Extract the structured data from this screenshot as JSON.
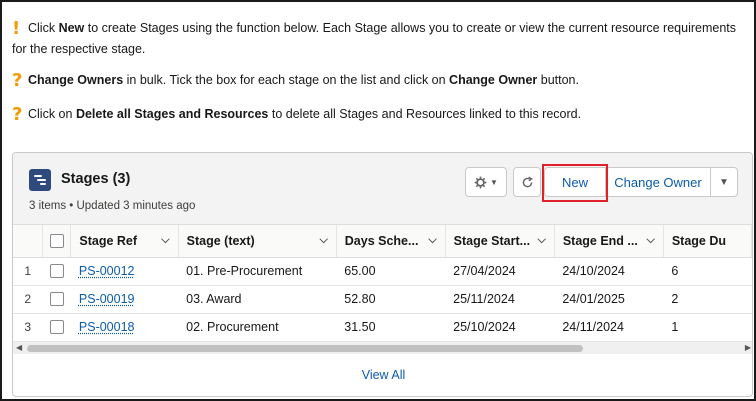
{
  "notes": [
    {
      "icon": "!",
      "parts": [
        {
          "t": "Click ",
          "b": false
        },
        {
          "t": "New",
          "b": true
        },
        {
          "t": " to create Stages using the function below. Each Stage allows you to create or view the current resource requirements for the respective stage.",
          "b": false
        }
      ]
    },
    {
      "icon": "?",
      "parts": [
        {
          "t": "Change Owners",
          "b": true
        },
        {
          "t": " in bulk. Tick the box for each stage on the list and click on ",
          "b": false
        },
        {
          "t": "Change Owner",
          "b": true
        },
        {
          "t": " button.",
          "b": false
        }
      ]
    },
    {
      "icon": "?",
      "parts": [
        {
          "t": "Click on ",
          "b": false
        },
        {
          "t": "Delete all Stages and Resources",
          "b": true
        },
        {
          "t": " to delete all Stages and Resources linked to this record.",
          "b": false
        }
      ]
    }
  ],
  "card": {
    "title": "Stages (3)",
    "subtitle": "3 items • Updated 3 minutes ago",
    "new_label": "New",
    "change_owner_label": "Change Owner"
  },
  "table": {
    "columns": [
      "Stage Ref",
      "Stage (text)",
      "Days Sche...",
      "Stage Start...",
      "Stage End ...",
      "Stage Du"
    ],
    "rows": [
      {
        "num": "1",
        "ref": "PS-00012",
        "stage": "01. Pre-Procurement",
        "days": "65.00",
        "start": "27/04/2024",
        "end": "24/10/2024",
        "dur": "6"
      },
      {
        "num": "2",
        "ref": "PS-00019",
        "stage": "03. Award",
        "days": "52.80",
        "start": "25/11/2024",
        "end": "24/01/2025",
        "dur": "2"
      },
      {
        "num": "3",
        "ref": "PS-00018",
        "stage": "02. Procurement",
        "days": "31.50",
        "start": "25/10/2024",
        "end": "24/11/2024",
        "dur": "1"
      }
    ]
  },
  "footer": {
    "view_all": "View All"
  },
  "colors": {
    "accent": "#0b5cab",
    "highlight": "#e0202a",
    "warning": "#f59b00"
  },
  "icons": [
    "exclamation-icon",
    "question-icon",
    "stages-icon",
    "gear-icon",
    "refresh-icon",
    "chevron-down-icon"
  ]
}
